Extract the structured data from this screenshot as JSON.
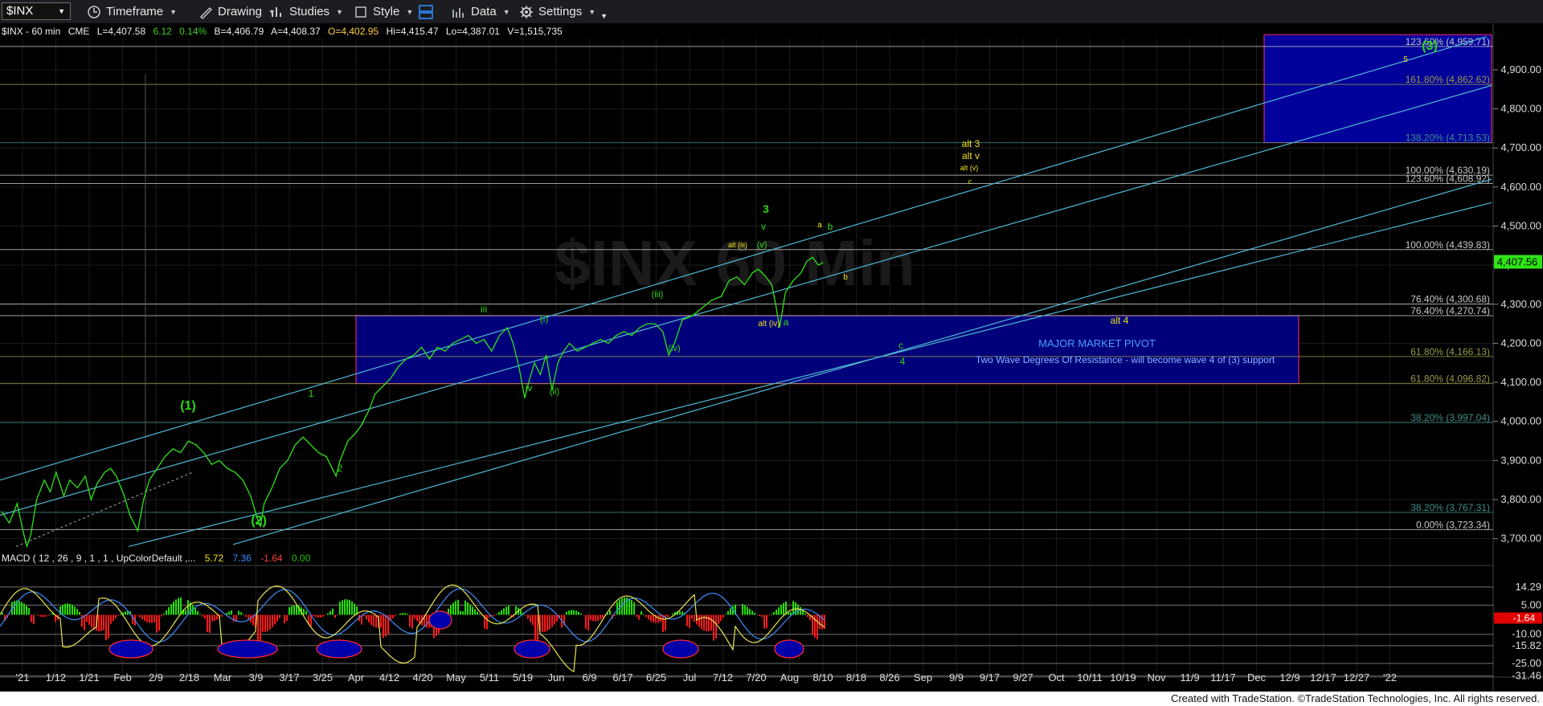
{
  "toolbar": {
    "symbol": "$INX",
    "timeframe_label": "Timeframe",
    "drawing_label": "Drawing",
    "studies_label": "Studies",
    "style_label": "Style",
    "data_label": "Data",
    "settings_label": "Settings"
  },
  "ohlc_header": {
    "symbol": "$INX - 60 min",
    "exchange": "CME",
    "last": "L=4,407.58",
    "change": "6.12",
    "change_pct": "0.14%",
    "bid": "B=4,406.79",
    "ask": "A=4,408.37",
    "open": "O=4,402.95",
    "high": "Hi=4,415.47",
    "low": "Lo=4,387.01",
    "volume": "V=1,515,735"
  },
  "watermark": "$INX 60 Min",
  "footer": "Created with TradeStation. ©TradeStation Technologies, Inc. All rights reserved.",
  "chart_data": {
    "type": "line",
    "colors": {
      "price": "#2ee516",
      "up": "#22e000",
      "down": "#ff1a1a",
      "macd": "#e6e650",
      "signal": "#3a8dff",
      "box": "#00007a",
      "channel": "#50b9d5",
      "fib_gray": "#c8c8c8",
      "fib_olive": "#9a9a4a",
      "fib_teal": "#3f8f8a"
    },
    "price_axis": {
      "min": 3650,
      "max": 4980,
      "ticks": [
        3700,
        3800,
        3900,
        4000,
        4100,
        4200,
        4300,
        4400,
        4500,
        4600,
        4700,
        4800,
        4900
      ]
    },
    "x_ticks": [
      "'21",
      "1/12",
      "1/21",
      "Feb",
      "2/9",
      "2/18",
      "Mar",
      "3/9",
      "3/17",
      "3/25",
      "Apr",
      "4/12",
      "4/20",
      "May",
      "5/11",
      "5/19",
      "Jun",
      "6/9",
      "6/17",
      "6/25",
      "Jul",
      "7/12",
      "7/20",
      "Aug",
      "8/10",
      "8/18",
      "8/26",
      "Sep",
      "9/9",
      "9/17",
      "9/27",
      "Oct",
      "10/11",
      "10/19",
      "Nov",
      "11/9",
      "11/17",
      "Dec",
      "12/9",
      "12/17",
      "12/27",
      "'22"
    ],
    "price_series": [
      [
        0,
        3770
      ],
      [
        8,
        3740
      ],
      [
        16,
        3790
      ],
      [
        22,
        3720
      ],
      [
        26,
        3680
      ],
      [
        30,
        3710
      ],
      [
        36,
        3800
      ],
      [
        44,
        3850
      ],
      [
        50,
        3820
      ],
      [
        56,
        3870
      ],
      [
        64,
        3810
      ],
      [
        70,
        3850
      ],
      [
        78,
        3830
      ],
      [
        86,
        3860
      ],
      [
        92,
        3800
      ],
      [
        98,
        3840
      ],
      [
        106,
        3870
      ],
      [
        112,
        3880
      ],
      [
        118,
        3860
      ],
      [
        126,
        3810
      ],
      [
        132,
        3760
      ],
      [
        140,
        3720
      ],
      [
        146,
        3800
      ],
      [
        152,
        3850
      ],
      [
        160,
        3880
      ],
      [
        168,
        3910
      ],
      [
        176,
        3930
      ],
      [
        184,
        3920
      ],
      [
        192,
        3950
      ],
      [
        200,
        3940
      ],
      [
        208,
        3920
      ],
      [
        216,
        3890
      ],
      [
        224,
        3900
      ],
      [
        232,
        3880
      ],
      [
        240,
        3870
      ],
      [
        248,
        3850
      ],
      [
        256,
        3810
      ],
      [
        262,
        3760
      ],
      [
        266,
        3730
      ],
      [
        270,
        3790
      ],
      [
        278,
        3830
      ],
      [
        286,
        3880
      ],
      [
        294,
        3900
      ],
      [
        302,
        3940
      ],
      [
        310,
        3960
      ],
      [
        318,
        3940
      ],
      [
        326,
        3920
      ],
      [
        334,
        3910
      ],
      [
        340,
        3880
      ],
      [
        344,
        3860
      ],
      [
        348,
        3900
      ],
      [
        356,
        3950
      ],
      [
        364,
        3970
      ],
      [
        370,
        3990
      ],
      [
        378,
        4030
      ],
      [
        384,
        4070
      ],
      [
        392,
        4090
      ],
      [
        400,
        4110
      ],
      [
        408,
        4140
      ],
      [
        416,
        4160
      ],
      [
        424,
        4170
      ],
      [
        432,
        4190
      ],
      [
        440,
        4160
      ],
      [
        448,
        4190
      ],
      [
        456,
        4180
      ],
      [
        464,
        4200
      ],
      [
        472,
        4210
      ],
      [
        480,
        4220
      ],
      [
        488,
        4200
      ],
      [
        496,
        4210
      ],
      [
        504,
        4180
      ],
      [
        512,
        4220
      ],
      [
        520,
        4240
      ],
      [
        526,
        4200
      ],
      [
        532,
        4140
      ],
      [
        538,
        4060
      ],
      [
        542,
        4100
      ],
      [
        548,
        4150
      ],
      [
        554,
        4120
      ],
      [
        560,
        4170
      ],
      [
        566,
        4080
      ],
      [
        572,
        4150
      ],
      [
        578,
        4180
      ],
      [
        584,
        4200
      ],
      [
        592,
        4180
      ],
      [
        600,
        4190
      ],
      [
        608,
        4200
      ],
      [
        616,
        4210
      ],
      [
        624,
        4200
      ],
      [
        632,
        4220
      ],
      [
        640,
        4230
      ],
      [
        648,
        4220
      ],
      [
        656,
        4240
      ],
      [
        664,
        4250
      ],
      [
        672,
        4250
      ],
      [
        680,
        4230
      ],
      [
        686,
        4170
      ],
      [
        692,
        4200
      ],
      [
        700,
        4260
      ],
      [
        710,
        4270
      ],
      [
        720,
        4290
      ],
      [
        730,
        4310
      ],
      [
        740,
        4320
      ],
      [
        748,
        4360
      ],
      [
        756,
        4370
      ],
      [
        764,
        4350
      ],
      [
        772,
        4380
      ],
      [
        778,
        4390
      ],
      [
        786,
        4370
      ],
      [
        792,
        4350
      ],
      [
        796,
        4300
      ],
      [
        800,
        4240
      ],
      [
        806,
        4330
      ],
      [
        814,
        4360
      ],
      [
        822,
        4380
      ],
      [
        828,
        4410
      ],
      [
        834,
        4420
      ],
      [
        840,
        4400
      ],
      [
        845,
        4407
      ]
    ],
    "fib_levels": [
      {
        "label": "123.60% (4,959.71)",
        "value": 4959.71,
        "color": "gray"
      },
      {
        "label": "161.80% (4,862.62)",
        "value": 4862.62,
        "color": "olive"
      },
      {
        "label": "138.20% (4,713.53)",
        "value": 4713.53,
        "color": "teal"
      },
      {
        "label": "100.00% (4,630.19)",
        "value": 4630.19,
        "color": "gray"
      },
      {
        "label": "123.60% (4,608.92)",
        "value": 4608.92,
        "color": "gray"
      },
      {
        "label": "100.00% (4,439.83)",
        "value": 4439.83,
        "color": "gray"
      },
      {
        "label": "76.40% (4,300.68)",
        "value": 4300.68,
        "color": "gray"
      },
      {
        "label": "76.40% (4,270.74)",
        "value": 4270.74,
        "color": "gray"
      },
      {
        "label": "61.80% (4,166.13)",
        "value": 4166.13,
        "color": "olive"
      },
      {
        "label": "61.80% (4,096.82)",
        "value": 4096.82,
        "color": "olive"
      },
      {
        "label": "38.20% (3,997.04)",
        "value": 3997.04,
        "color": "teal"
      },
      {
        "label": "38.20% (3,767.31)",
        "value": 3767.31,
        "color": "teal"
      },
      {
        "label": "0.00% (3,723.34)",
        "value": 3723.34,
        "color": "gray"
      }
    ],
    "last_price_label": "4,407.56",
    "last_price": 4407.56,
    "wave_labels": [
      {
        "text": "(1)",
        "color": "green"
      },
      {
        "text": "(2)",
        "color": "green"
      },
      {
        "text": "1",
        "color": "green"
      },
      {
        "text": "2",
        "color": "green"
      },
      {
        "text": "iii",
        "color": "green"
      },
      {
        "text": "(i)",
        "color": "green"
      },
      {
        "text": "iv",
        "color": "green"
      },
      {
        "text": "(ii)",
        "color": "green"
      },
      {
        "text": "(iii)",
        "color": "green"
      },
      {
        "text": "(iv)",
        "color": "green"
      },
      {
        "text": "alt (iii)",
        "color": "yellow"
      },
      {
        "text": "(v)",
        "color": "green"
      },
      {
        "text": "v",
        "color": "green"
      },
      {
        "text": "3",
        "color": "green"
      },
      {
        "text": "alt (iv)",
        "color": "yellow"
      },
      {
        "text": "a",
        "color": "green"
      },
      {
        "text": "a",
        "color": "yellow"
      },
      {
        "text": "b",
        "color": "green"
      },
      {
        "text": "b",
        "color": "yellow"
      },
      {
        "text": "alt 3",
        "color": "yellow"
      },
      {
        "text": "alt v",
        "color": "yellow"
      },
      {
        "text": "alt (v)",
        "color": "yellow"
      },
      {
        "text": "c",
        "color": "yellow"
      },
      {
        "text": "c",
        "color": "green"
      },
      {
        "text": "4",
        "color": "green"
      },
      {
        "text": "(3)",
        "color": "green"
      },
      {
        "text": "5",
        "color": "yellow"
      }
    ],
    "box_annotations": {
      "alt4": "alt 4",
      "pivot": "MAJOR MARKET PIVOT",
      "resistance": "Two Wave Degrees Of Resistance - will become wave 4 of (3) support"
    },
    "macd": {
      "header": "MACD ( 12 , 26 , 9 , 1 , 1 , UpColorDefault ,...",
      "macd_value": "5.72",
      "signal_value": "7.36",
      "diff_value": "-1.64",
      "zero_value": "0.00",
      "axis_min": -32,
      "axis_max": 25,
      "ticks": [
        {
          "label": "14.29",
          "value": 14.29
        },
        {
          "label": "5.00",
          "value": 5
        },
        {
          "label": "-10.00",
          "value": -10
        },
        {
          "label": "-15.82",
          "value": -15.82
        },
        {
          "label": "-25.00",
          "value": -25
        },
        {
          "label": "-31.46",
          "value": -31.46
        }
      ],
      "current_label": "-1.64",
      "current_value": -1.64
    }
  }
}
